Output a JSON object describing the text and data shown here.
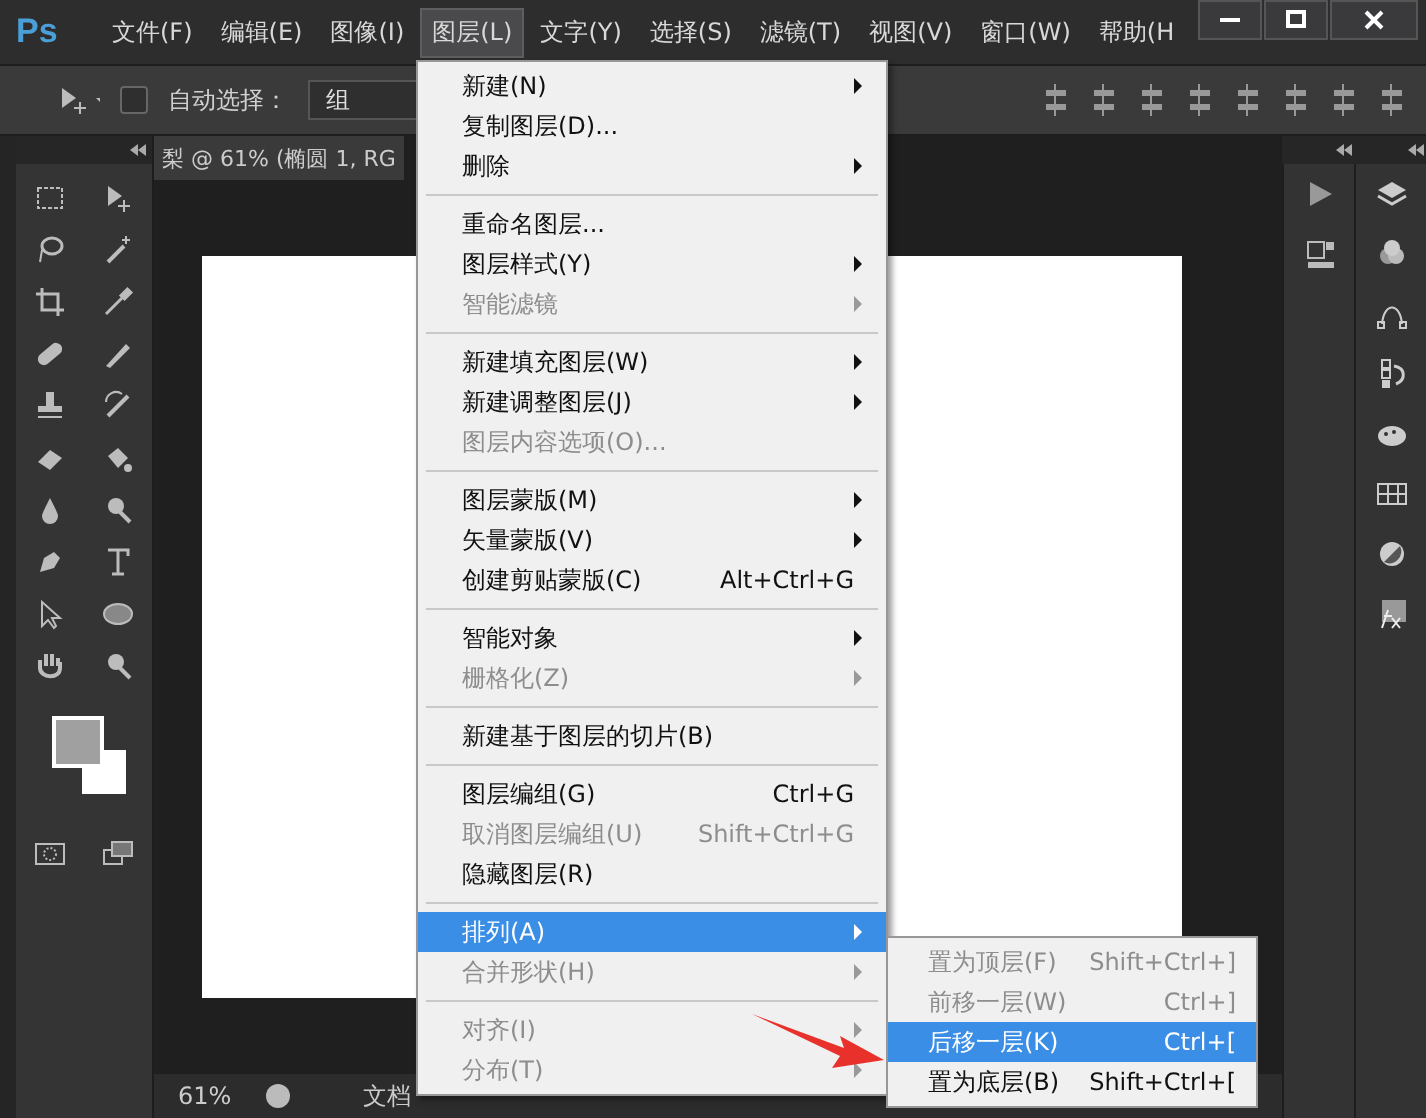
{
  "app": {
    "logo": "Ps"
  },
  "menubar": [
    {
      "label": "文件(F)",
      "selected": false
    },
    {
      "label": "编辑(E)",
      "selected": false
    },
    {
      "label": "图像(I)",
      "selected": false
    },
    {
      "label": "图层(L)",
      "selected": true
    },
    {
      "label": "文字(Y)",
      "selected": false
    },
    {
      "label": "选择(S)",
      "selected": false
    },
    {
      "label": "滤镜(T)",
      "selected": false
    },
    {
      "label": "视图(V)",
      "selected": false
    },
    {
      "label": "窗口(W)",
      "selected": false
    },
    {
      "label": "帮助(H",
      "selected": false
    }
  ],
  "options_bar": {
    "auto_select": {
      "label": "自动选择：",
      "checked": false
    },
    "target": {
      "value": "组"
    }
  },
  "document": {
    "tab_title": "梨 @ 61% (椭圆 1, RG"
  },
  "status_bar": {
    "zoom": "61%",
    "info": "文档"
  },
  "layer_menu": [
    {
      "kind": "item",
      "label": "新建(N)",
      "submenu": true,
      "disabled": false,
      "selected": false
    },
    {
      "kind": "item",
      "label": "复制图层(D)...",
      "submenu": false,
      "disabled": false,
      "selected": false
    },
    {
      "kind": "item",
      "label": "删除",
      "submenu": true,
      "disabled": false,
      "selected": false
    },
    {
      "kind": "separator"
    },
    {
      "kind": "item",
      "label": "重命名图层...",
      "submenu": false,
      "disabled": false,
      "selected": false
    },
    {
      "kind": "item",
      "label": "图层样式(Y)",
      "submenu": true,
      "disabled": false,
      "selected": false
    },
    {
      "kind": "item",
      "label": "智能滤镜",
      "submenu": true,
      "disabled": true,
      "selected": false
    },
    {
      "kind": "separator"
    },
    {
      "kind": "item",
      "label": "新建填充图层(W)",
      "submenu": true,
      "disabled": false,
      "selected": false
    },
    {
      "kind": "item",
      "label": "新建调整图层(J)",
      "submenu": true,
      "disabled": false,
      "selected": false
    },
    {
      "kind": "item",
      "label": "图层内容选项(O)...",
      "submenu": false,
      "disabled": true,
      "selected": false
    },
    {
      "kind": "separator"
    },
    {
      "kind": "item",
      "label": "图层蒙版(M)",
      "submenu": true,
      "disabled": false,
      "selected": false
    },
    {
      "kind": "item",
      "label": "矢量蒙版(V)",
      "submenu": true,
      "disabled": false,
      "selected": false
    },
    {
      "kind": "item",
      "label": "创建剪贴蒙版(C)",
      "shortcut": "Alt+Ctrl+G",
      "submenu": false,
      "disabled": false,
      "selected": false
    },
    {
      "kind": "separator"
    },
    {
      "kind": "item",
      "label": "智能对象",
      "submenu": true,
      "disabled": false,
      "selected": false
    },
    {
      "kind": "item",
      "label": "栅格化(Z)",
      "submenu": true,
      "disabled": true,
      "selected": false
    },
    {
      "kind": "separator"
    },
    {
      "kind": "item",
      "label": "新建基于图层的切片(B)",
      "submenu": false,
      "disabled": false,
      "selected": false
    },
    {
      "kind": "separator"
    },
    {
      "kind": "item",
      "label": "图层编组(G)",
      "shortcut": "Ctrl+G",
      "submenu": false,
      "disabled": false,
      "selected": false
    },
    {
      "kind": "item",
      "label": "取消图层编组(U)",
      "shortcut": "Shift+Ctrl+G",
      "submenu": false,
      "disabled": true,
      "selected": false
    },
    {
      "kind": "item",
      "label": "隐藏图层(R)",
      "submenu": false,
      "disabled": false,
      "selected": false
    },
    {
      "kind": "separator"
    },
    {
      "kind": "item",
      "label": "排列(A)",
      "submenu": true,
      "disabled": false,
      "selected": true
    },
    {
      "kind": "item",
      "label": "合并形状(H)",
      "submenu": true,
      "disabled": true,
      "selected": false
    },
    {
      "kind": "separator"
    },
    {
      "kind": "item",
      "label": "对齐(I)",
      "submenu": true,
      "disabled": true,
      "selected": false
    },
    {
      "kind": "item",
      "label": "分布(T)",
      "submenu": true,
      "disabled": true,
      "selected": false
    }
  ],
  "arrange_submenu": [
    {
      "label": "置为顶层(F)",
      "shortcut": "Shift+Ctrl+]",
      "disabled": true,
      "selected": false
    },
    {
      "label": "前移一层(W)",
      "shortcut": "Ctrl+]",
      "disabled": true,
      "selected": false
    },
    {
      "label": "后移一层(K)",
      "shortcut": "Ctrl+[",
      "disabled": false,
      "selected": true
    },
    {
      "label": "置为底层(B)",
      "shortcut": "Shift+Ctrl+[",
      "disabled": false,
      "selected": false
    }
  ]
}
